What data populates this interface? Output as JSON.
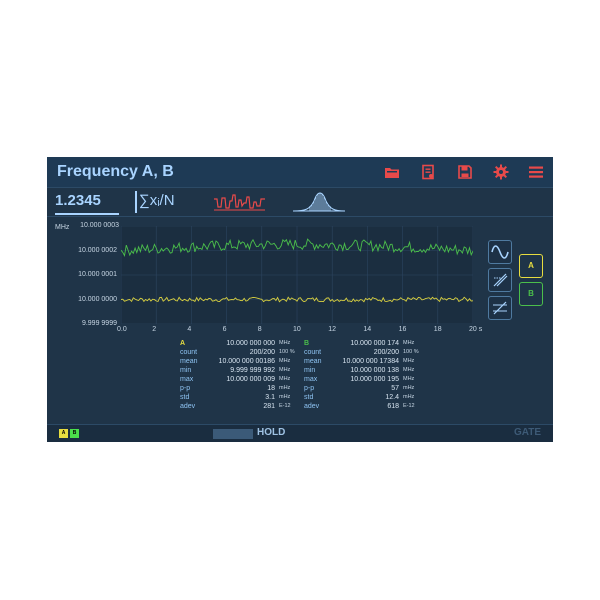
{
  "window": {
    "title": "Frequency A, B"
  },
  "toolbar": {
    "icons": [
      "folder-icon",
      "document-settings-icon",
      "save-icon",
      "gear-icon",
      "hamburger-menu-icon"
    ],
    "accent": "#e84a4a"
  },
  "modes": {
    "value_label": "1.2345",
    "stats_label": "∑xᵢ/N"
  },
  "plot": {
    "y_unit": "MHz",
    "y_ticks": [
      "10.000 0003",
      "10.000 0002",
      "10.000 0001",
      "10.000 0000",
      "9.999 9999"
    ],
    "x_ticks": [
      "0.0",
      "2",
      "4",
      "6",
      "8",
      "10",
      "12",
      "14",
      "16",
      "18",
      "20 s"
    ]
  },
  "chart_data": {
    "type": "line",
    "ylabel": "MHz",
    "ylim": [
      9.9999999,
      10.0000003
    ],
    "xlim": [
      0,
      20
    ],
    "series": [
      {
        "name": "A",
        "color": "#d8d040",
        "level": 10.0
      },
      {
        "name": "B",
        "color": "#4bbf4b",
        "level": 10.0000002
      }
    ]
  },
  "side": {
    "buttons": [
      "sine-wave-icon",
      "auto-trigger-icon",
      "manual-trigger-icon"
    ],
    "channel_a": "A",
    "channel_b": "B",
    "color_a": "#e7dd40",
    "color_b": "#4bbf4b"
  },
  "stats": {
    "a": {
      "header": "A",
      "value": "10.000 000 000",
      "value_unit": "MHz",
      "rows": [
        {
          "label": "count",
          "value": "200/200",
          "unit": "100 %"
        },
        {
          "label": "mean",
          "value": "10.000 000 00186",
          "unit": "MHz"
        },
        {
          "label": "min",
          "value": "9.999 999 992",
          "unit": "MHz"
        },
        {
          "label": "max",
          "value": "10.000 000 009",
          "unit": "MHz"
        },
        {
          "label": "p-p",
          "value": "18",
          "unit": "mHz"
        },
        {
          "label": "std",
          "value": "3.1",
          "unit": "mHz"
        },
        {
          "label": "adev",
          "value": "281",
          "unit": "E-12"
        }
      ]
    },
    "b": {
      "header": "B",
      "value": "10.000 000 174",
      "value_unit": "MHz",
      "rows": [
        {
          "label": "count",
          "value": "200/200",
          "unit": "100 %"
        },
        {
          "label": "mean",
          "value": "10.000 000 17384",
          "unit": "MHz"
        },
        {
          "label": "min",
          "value": "10.000 000 138",
          "unit": "MHz"
        },
        {
          "label": "max",
          "value": "10.000 000 195",
          "unit": "MHz"
        },
        {
          "label": "p-p",
          "value": "57",
          "unit": "mHz"
        },
        {
          "label": "std",
          "value": "12.4",
          "unit": "mHz"
        },
        {
          "label": "adev",
          "value": "618",
          "unit": "E-12"
        }
      ]
    }
  },
  "status": {
    "led_a": "A",
    "led_b": "B",
    "hold": "HOLD",
    "gate": "GATE"
  }
}
